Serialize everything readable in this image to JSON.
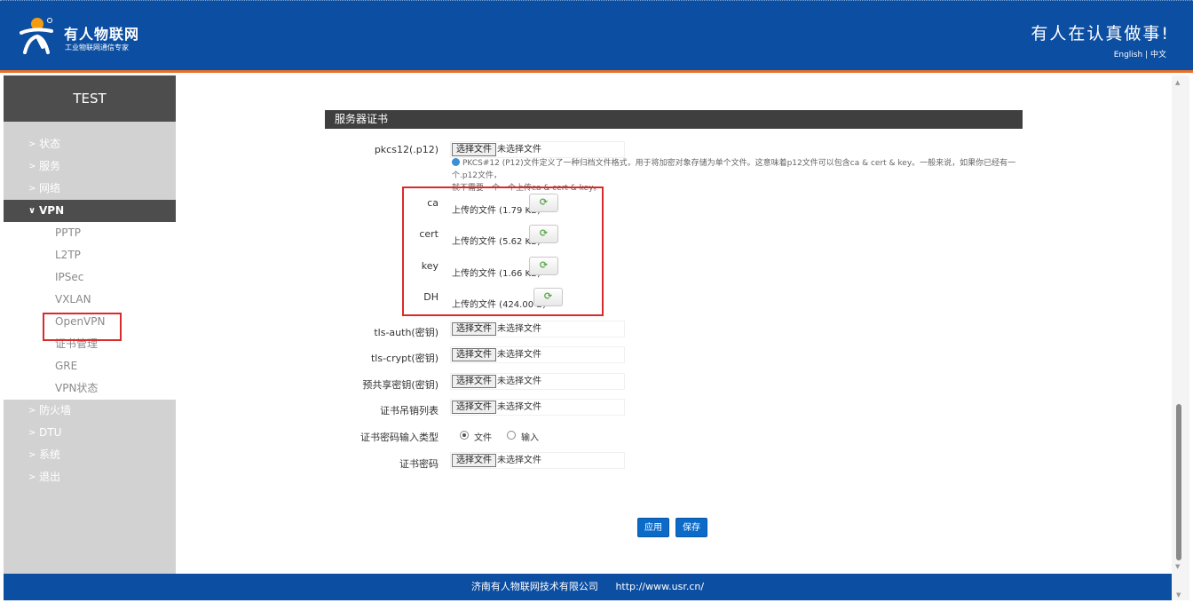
{
  "header": {
    "brand_name": "有人物联网",
    "brand_sub": "工业物联网通信专家",
    "slogan": "有人在认真做事!",
    "lang_en": "English",
    "lang_sep": "|",
    "lang_zh": "中文"
  },
  "sidebar": {
    "device_name": "TEST",
    "items": [
      {
        "label": "状态"
      },
      {
        "label": "服务"
      },
      {
        "label": "网络"
      },
      {
        "label": "VPN"
      },
      {
        "label": "防火墙"
      },
      {
        "label": "DTU"
      },
      {
        "label": "系统"
      },
      {
        "label": "退出"
      }
    ],
    "vpn_sub": [
      {
        "label": "PPTP"
      },
      {
        "label": "L2TP"
      },
      {
        "label": "IPSec"
      },
      {
        "label": "VXLAN"
      },
      {
        "label": "OpenVPN"
      },
      {
        "label": "证书管理"
      },
      {
        "label": "GRE"
      },
      {
        "label": "VPN状态"
      }
    ]
  },
  "main": {
    "section_title": "服务器证书",
    "file_button": "选择文件",
    "no_file": "未选择文件",
    "pkcs12_label": "pkcs12(.p12)",
    "pkcs12_help_1": "PKCS#12 (P12)文件定义了一种归档文件格式，用于将加密对象存储为单个文件。这意味着p12文件可以包含ca & cert & key。一般来说，如果你已经有一个.p12文件，",
    "pkcs12_help_2": "就不需要一个一个上传ca & cert & key。",
    "certs": [
      {
        "label": "ca",
        "value": "上传的文件 (1.79 KB)"
      },
      {
        "label": "cert",
        "value": "上传的文件 (5.62 KB)"
      },
      {
        "label": "key",
        "value": "上传的文件 (1.66 KB)"
      },
      {
        "label": "DH",
        "value": "上传的文件 (424.00 B)"
      }
    ],
    "tls_auth_label": "tls-auth(密钥)",
    "tls_crypt_label": "tls-crypt(密钥)",
    "psk_label": "预共享密钥(密钥)",
    "crl_label": "证书吊销列表",
    "pwd_type_label": "证书密码输入类型",
    "pwd_type_options": [
      {
        "label": "文件",
        "checked": true
      },
      {
        "label": "输入",
        "checked": false
      }
    ],
    "cert_pwd_label": "证书密码",
    "apply_button": "应用",
    "save_button": "保存"
  },
  "footer": {
    "company": "济南有人物联网技术有限公司",
    "url": "http://www.usr.cn/"
  },
  "colors": {
    "header_bg": "#0c4ea2",
    "accent_orange": "#e8702a",
    "highlight_red": "#d92b2b",
    "button_blue": "#0c6bc8"
  }
}
